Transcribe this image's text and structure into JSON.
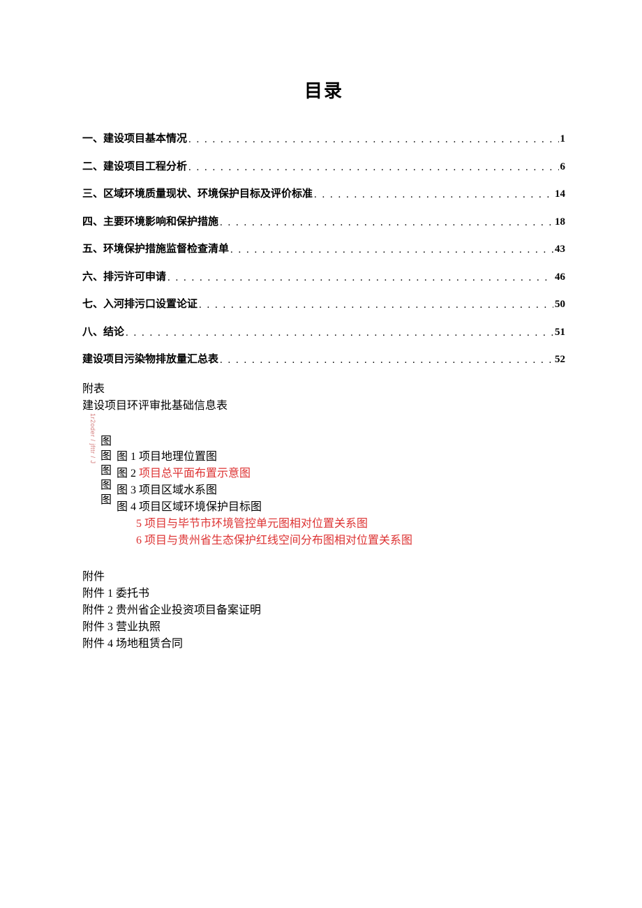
{
  "title": "目录",
  "toc": [
    {
      "label": "一、建设项目基本情况",
      "page": "1"
    },
    {
      "label": "二、建设项目工程分析",
      "page": "6"
    },
    {
      "label": "三、区域环境质量现状、环境保护目标及评价标准",
      "page": "14"
    },
    {
      "label": "四、主要环境影响和保护措施",
      "page": "18"
    },
    {
      "label": "五、环境保护措施监督检查清单",
      "page": "43"
    },
    {
      "label": "六、排污许可申请",
      "page": "46"
    },
    {
      "label": "七、入河排污口设置论证",
      "page": "50"
    },
    {
      "label": "八、结论",
      "page": "51"
    },
    {
      "label": "建设项目污染物排放量汇总表",
      "page": "52"
    }
  ],
  "fubiao": {
    "heading": "附表",
    "item": "建设项目环评审批基础信息表"
  },
  "futu": {
    "vert": [
      "图",
      "图",
      "图",
      "图",
      "图"
    ],
    "items": [
      {
        "prefix": "图 1 ",
        "text": "项目地理位置图",
        "red": false
      },
      {
        "prefix": "图 2 ",
        "text": "项目总平面布置示意图",
        "red": true
      },
      {
        "prefix": "图 3 ",
        "text": "项目区域水系图",
        "red": false
      },
      {
        "prefix": "图 4 ",
        "text": "项目区域环境保护目标图",
        "red": false
      },
      {
        "prefix": "5 ",
        "text": "项目与毕节市环境管控单元图相对位置关系图",
        "red": true,
        "indent": true
      },
      {
        "prefix": "6 ",
        "text": "项目与贵州省生态保护红线空间分布图相对位置关系图",
        "red": true,
        "indent": true
      }
    ]
  },
  "fujian": {
    "heading": "附件",
    "items": [
      "附件 1 委托书",
      "附件 2 贵州省企业投资项目备案证明",
      "附件 3 营业执照",
      "附件 4 场地租赁合同"
    ]
  },
  "watermark": "1r2oder / jfttr / J"
}
